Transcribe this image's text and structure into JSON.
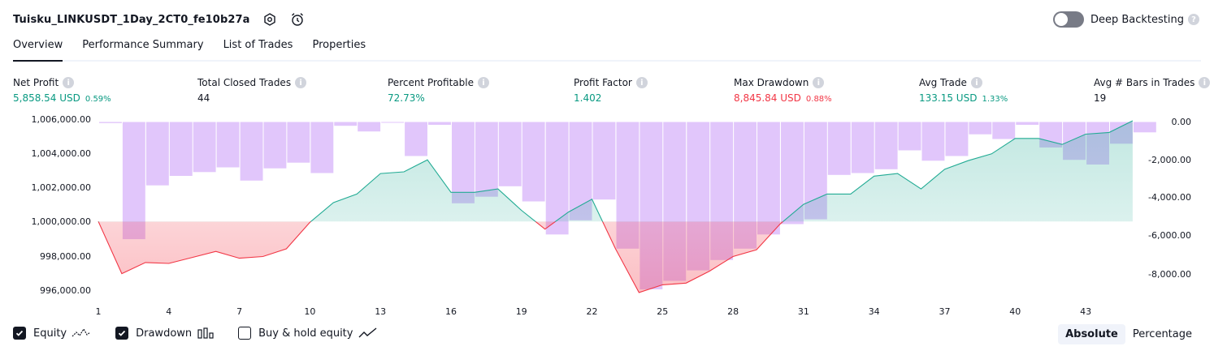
{
  "header": {
    "title": "Tuisku_LINKUSDT_1Day_2CT0_fe10b27a",
    "settings_icon": "gear-icon",
    "alert_icon": "alarm-clock-add-icon"
  },
  "deep_backtesting": {
    "label": "Deep Backtesting",
    "enabled": false,
    "help": "?"
  },
  "tabs": [
    {
      "label": "Overview",
      "active": true
    },
    {
      "label": "Performance Summary",
      "active": false
    },
    {
      "label": "List of Trades",
      "active": false
    },
    {
      "label": "Properties",
      "active": false
    }
  ],
  "metrics": {
    "net_profit": {
      "label": "Net Profit",
      "value": "5,858.54 USD",
      "pct": "0.59%"
    },
    "total_closed_trades": {
      "label": "Total Closed Trades",
      "value": "44"
    },
    "percent_profitable": {
      "label": "Percent Profitable",
      "value": "72.73%"
    },
    "profit_factor": {
      "label": "Profit Factor",
      "value": "1.402"
    },
    "max_drawdown": {
      "label": "Max Drawdown",
      "value": "8,845.84 USD",
      "pct": "0.88%"
    },
    "avg_trade": {
      "label": "Avg Trade",
      "value": "133.15 USD",
      "pct": "1.33%"
    },
    "avg_bars": {
      "label": "Avg # Bars in Trades",
      "value": "19"
    }
  },
  "chart_data": {
    "type": "line",
    "left_axis_ticks": [
      "1,006,000.00",
      "1,004,000.00",
      "1,002,000.00",
      "1,000,000.00",
      "998,000.00",
      "996,000.00"
    ],
    "right_axis_ticks": [
      "0.00",
      "-2,000.00",
      "-4,000.00",
      "-6,000.00",
      "-8,000.00"
    ],
    "x_ticks": [
      "1",
      "4",
      "7",
      "10",
      "13",
      "16",
      "19",
      "22",
      "25",
      "28",
      "31",
      "34",
      "37",
      "40",
      "43"
    ],
    "baseline": 1000000,
    "ylim": [
      995600,
      1006200
    ],
    "drawdown_ylim": [
      -9000,
      0
    ],
    "series": [
      {
        "name": "Equity",
        "x": [
          1,
          2,
          3,
          4,
          5,
          6,
          7,
          8,
          9,
          10,
          11,
          12,
          13,
          14,
          15,
          16,
          17,
          18,
          19,
          20,
          21,
          22,
          23,
          24,
          25,
          26,
          27,
          28,
          29,
          30,
          31,
          32,
          33,
          34,
          35,
          36,
          37,
          38,
          39,
          40,
          41,
          42,
          43,
          44,
          45
        ],
        "values": [
          1000000,
          996950,
          997600,
          997550,
          997900,
          998250,
          997850,
          997950,
          998400,
          999950,
          1001100,
          1001600,
          1002800,
          1002900,
          1003600,
          1001700,
          1001700,
          1001900,
          1000650,
          999550,
          1000550,
          1001300,
          998400,
          995850,
          996300,
          996400,
          997100,
          997950,
          998350,
          999850,
          1001000,
          1001600,
          1001600,
          1002650,
          1002800,
          1001900,
          1003050,
          1003550,
          1003950,
          1004850,
          1004850,
          1004500,
          1005100,
          1005200,
          1005880
        ]
      },
      {
        "name": "Drawdown",
        "x": [
          1,
          2,
          3,
          4,
          5,
          6,
          7,
          8,
          9,
          10,
          11,
          12,
          13,
          14,
          15,
          16,
          17,
          18,
          19,
          20,
          21,
          22,
          23,
          24,
          25,
          26,
          27,
          28,
          29,
          30,
          31,
          32,
          33,
          34,
          35,
          36,
          37,
          38,
          39,
          40,
          41,
          42,
          43,
          44,
          45
        ],
        "values": [
          -60,
          -6200,
          -3350,
          -2850,
          -2650,
          -2400,
          -3100,
          -2450,
          -2150,
          -2700,
          -200,
          -500,
          0,
          -1800,
          -150,
          -4300,
          -3950,
          -3400,
          -4200,
          -5950,
          -5200,
          -4100,
          -6700,
          -8850,
          -8400,
          -7850,
          -7300,
          -6700,
          -5950,
          -5400,
          -5150,
          -2800,
          -2700,
          -2500,
          -1500,
          -2050,
          -1800,
          -650,
          -900,
          -150,
          -1350,
          -2000,
          -2250,
          -1150,
          -550
        ]
      }
    ]
  },
  "legend": {
    "equity": {
      "label": "Equity",
      "checked": true
    },
    "drawdown": {
      "label": "Drawdown",
      "checked": true
    },
    "buy_hold": {
      "label": "Buy & hold equity",
      "checked": false
    }
  },
  "mode_toggle": {
    "absolute": "Absolute",
    "percentage": "Percentage",
    "active": "Absolute"
  },
  "colors": {
    "profit": "#089981",
    "loss": "#f23645",
    "drawdown_bar": "#e1c6fb",
    "equity_line": "#22ab94"
  }
}
